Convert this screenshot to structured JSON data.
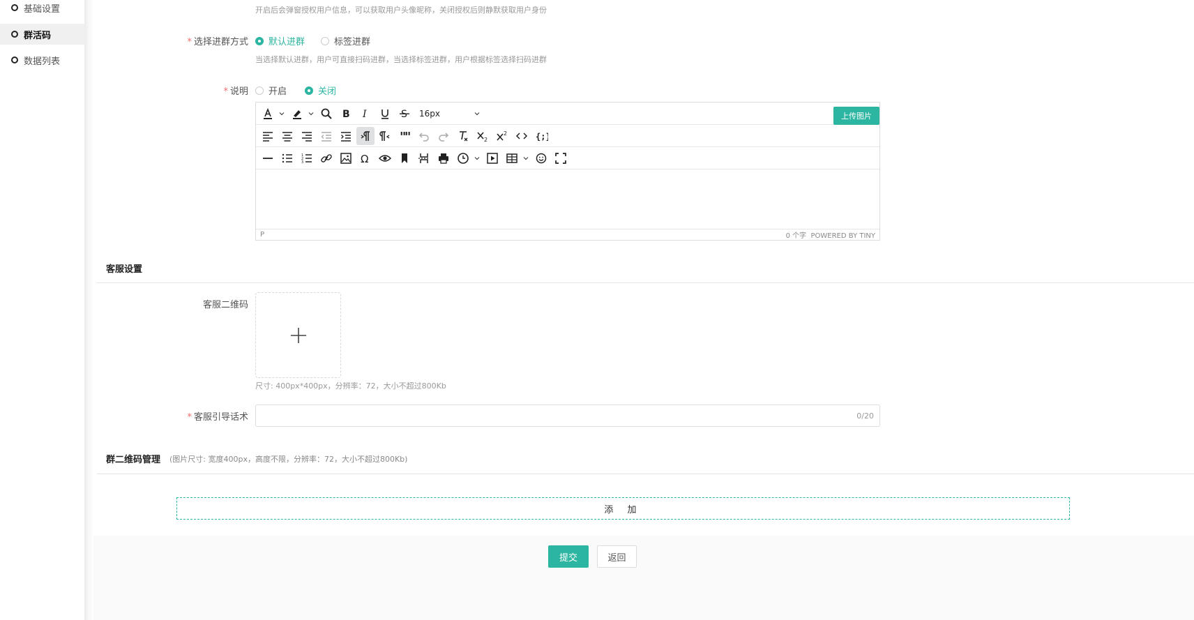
{
  "sidebar": {
    "items": [
      {
        "label": "基础设置",
        "active": false
      },
      {
        "label": "群活码",
        "active": true
      },
      {
        "label": "数据列表",
        "active": false
      }
    ]
  },
  "form": {
    "auth_hint": "开启后会弹窗授权用户信息，可以获取用户头像昵称，关闭授权后则静默获取用户身份",
    "join_mode": {
      "label": "选择进群方式",
      "options": [
        "默认进群",
        "标签进群"
      ],
      "selected": "默认进群",
      "hint": "当选择默认进群，用户可直接扫码进群，当选择标签进群，用户根据标签选择扫码进群"
    },
    "description": {
      "label": "说明",
      "options": [
        "开启",
        "关闭"
      ],
      "selected": "关闭"
    },
    "editor": {
      "font_size": "16px",
      "upload_image_label": "上传图片",
      "status_path": "P",
      "word_count": "0 个字",
      "powered_by": "POWERED BY TINY"
    }
  },
  "service_section": {
    "title": "客服设置",
    "qr_label": "客服二维码",
    "qr_hint": "尺寸: 400px*400px，分辨率：72，大小不超过800Kb",
    "guide_label": "客服引导话术",
    "guide_value": "",
    "guide_counter": "0/20"
  },
  "group_qr_section": {
    "title": "群二维码管理",
    "note": "(图片尺寸: 宽度400px，高度不限，分辨率：72，大小不超过800Kb)",
    "add_label": "添 加"
  },
  "footer": {
    "submit_label": "提交",
    "back_label": "返回"
  },
  "colors": {
    "accent": "#2cb5a0",
    "required": "#f56c6c"
  }
}
